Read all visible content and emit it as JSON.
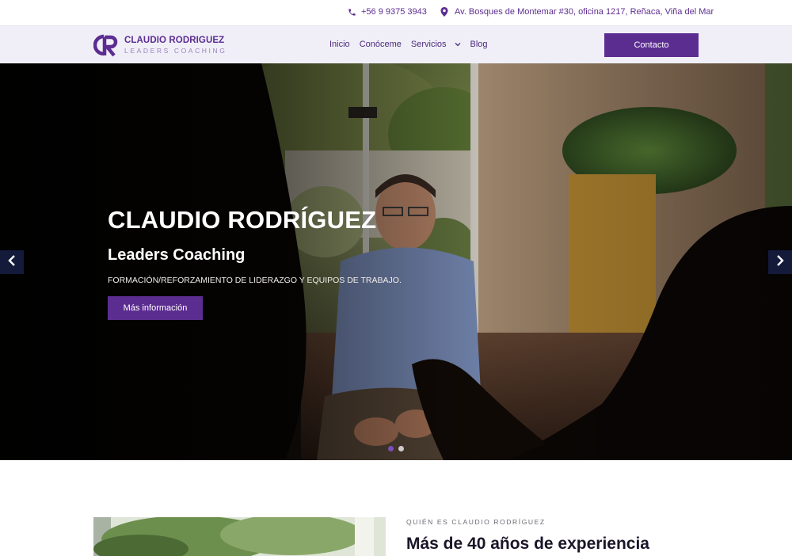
{
  "topbar": {
    "phone": "+56 9 9375 3943",
    "address": "Av. Bosques de Montemar #30, oficina 1217, Reñaca, Viña del Mar",
    "phone_icon": "phone-icon",
    "address_icon": "map-pin-icon"
  },
  "header": {
    "logo": {
      "monogram": "CR",
      "name": "CLAUDIO RODRIGUEZ",
      "subtitle": "LEADERS COACHING"
    },
    "nav": [
      {
        "label": "Inicio"
      },
      {
        "label": "Conóceme"
      },
      {
        "label": "Servicios",
        "has_dropdown": true
      },
      {
        "label": "Blog"
      }
    ],
    "contact_label": "Contacto"
  },
  "hero": {
    "title": "CLAUDIO RODRÍGUEZ",
    "subtitle": "Leaders Coaching",
    "tagline": "FORMACIÓN/REFORZAMIENTO DE LIDERAZGO Y EQUIPOS DE TRABAJO.",
    "button_label": "Más información",
    "slide_count": 2,
    "active_slide": 1
  },
  "about": {
    "eyebrow": "QUIÉN ES CLAUDIO RODRÍGUEZ",
    "heading": "Más de 40 años de experiencia"
  },
  "colors": {
    "brand_purple": "#5c2d91",
    "header_bg": "#f0eff8",
    "arrow_bg": "#141a3a"
  }
}
